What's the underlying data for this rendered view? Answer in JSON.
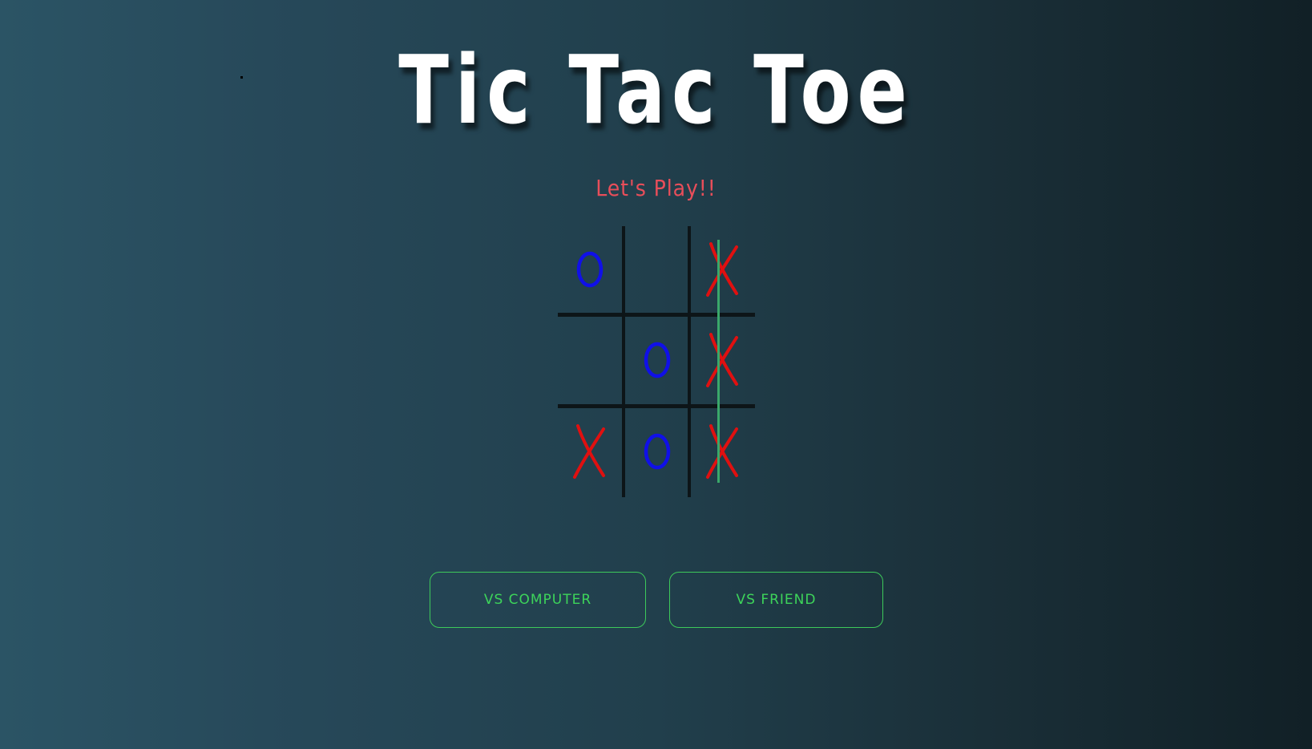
{
  "title": "Tic Tac Toe",
  "subtitle": "Let's Play!!",
  "colors": {
    "title": "#ffffff",
    "subtitle": "#e84e5a",
    "x_mark": "#e01010",
    "o_mark": "#1010e8",
    "grid": "#0d1518",
    "win_line": "#3aa86a",
    "button_accent": "#3dd45a"
  },
  "board": {
    "cells": [
      [
        "O",
        "",
        "X"
      ],
      [
        "",
        "O",
        "X"
      ],
      [
        "X",
        "O",
        "X"
      ]
    ],
    "winning_line": "column-3"
  },
  "buttons": {
    "vs_computer": "VS COMPUTER",
    "vs_friend": "VS FRIEND"
  }
}
